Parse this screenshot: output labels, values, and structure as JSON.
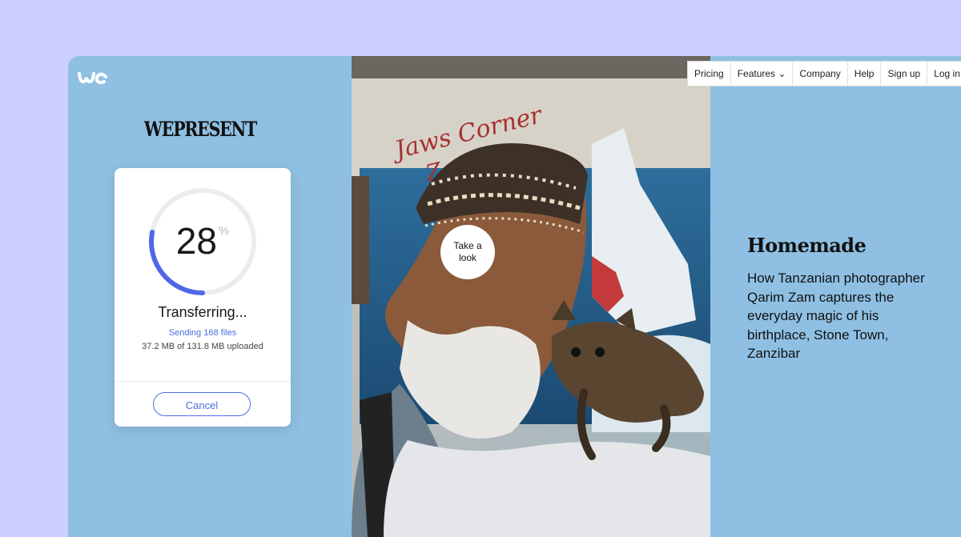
{
  "brand": {
    "logo_text": "we",
    "publication": "WEPRESENT"
  },
  "transfer": {
    "percent": 28,
    "percent_label": "28",
    "percent_sign": "%",
    "status": "Transferring...",
    "sending": "Sending 168 files",
    "uploaded": "37.2 MB of 131.8 MB uploaded",
    "cancel_label": "Cancel",
    "progress_color": "#5068e6",
    "track_color": "#ececee"
  },
  "photo": {
    "take_look": "Take a look",
    "mural_text_1": "Jaws Corner",
    "mural_text_2": "Zanzibar"
  },
  "nav": {
    "items": [
      "Pricing",
      "Features ⌄",
      "Company",
      "Help",
      "Sign up",
      "Log in"
    ]
  },
  "article": {
    "title": "Homemade",
    "description": "How Tanzanian photographer Qarim Zam captures the everyday magic of his birthplace, Stone Town, Zanzibar"
  }
}
